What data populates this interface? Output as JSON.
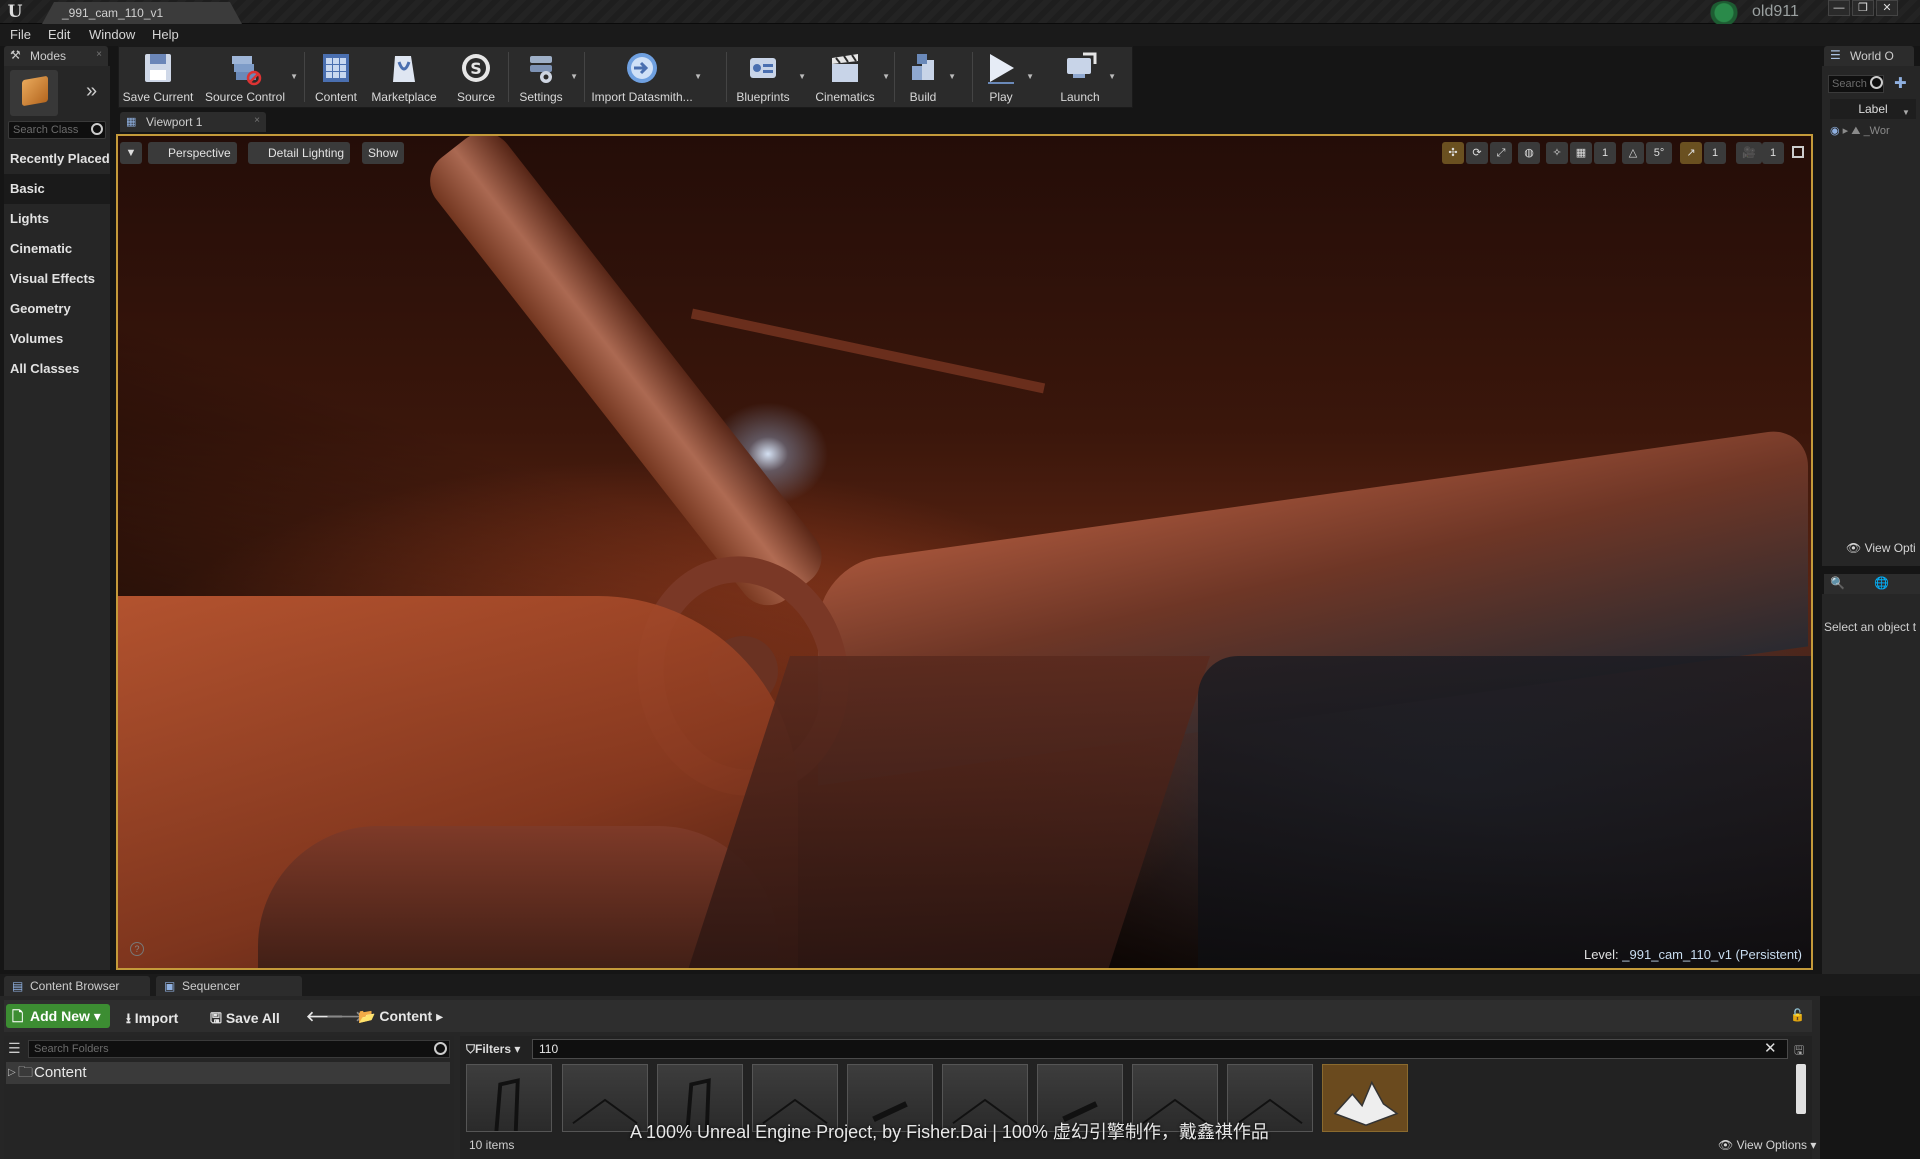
{
  "window": {
    "tab_title": "_991_cam_110_v1",
    "user": "old911",
    "controls": [
      "—",
      "❐",
      "✕"
    ]
  },
  "menu": [
    "File",
    "Edit",
    "Window",
    "Help"
  ],
  "modes": {
    "tab_label": "Modes",
    "search_placeholder": "Search Class",
    "categories": [
      "Recently Placed",
      "Basic",
      "Lights",
      "Cinematic",
      "Visual Effects",
      "Geometry",
      "Volumes",
      "All Classes"
    ],
    "active_category": "Basic"
  },
  "toolbar": [
    {
      "label": "Save Current",
      "icon": "save-icon"
    },
    {
      "label": "Source Control",
      "icon": "source-control-icon"
    },
    {
      "label": "Content",
      "icon": "content-icon"
    },
    {
      "label": "Marketplace",
      "icon": "marketplace-icon"
    },
    {
      "label": "Source",
      "icon": "source-icon"
    },
    {
      "label": "Settings",
      "icon": "settings-icon"
    },
    {
      "label": "Import Datasmith...",
      "icon": "datasmith-icon"
    },
    {
      "label": "Blueprints",
      "icon": "blueprints-icon"
    },
    {
      "label": "Cinematics",
      "icon": "cinematics-icon"
    },
    {
      "label": "Build",
      "icon": "build-icon"
    },
    {
      "label": "Play",
      "icon": "play-icon"
    },
    {
      "label": "Launch",
      "icon": "launch-icon"
    }
  ],
  "viewport": {
    "tab_label": "Viewport 1",
    "buttons": [
      "Perspective",
      "Detail Lighting",
      "Show"
    ],
    "right_icons": [
      "1",
      "5°",
      "1",
      "1"
    ],
    "level_prefix": "Level:",
    "level_name": "_991_cam_110_v1 (Persistent)",
    "accent_color": "#c49a3a"
  },
  "watermark": "A 100% Unreal Engine Project,  by Fisher.Dai | 100% 虚幻引擎制作，戴鑫祺作品",
  "world_outliner": {
    "tab_label": "World O",
    "search_placeholder": "Search",
    "column": "Label",
    "row": "_Wor",
    "view_options": "View Opti"
  },
  "details": {
    "hint": "Select an object t"
  },
  "content_browser": {
    "tabs": [
      "Content Browser",
      "Sequencer"
    ],
    "add_new": "Add New",
    "import": "Import",
    "save_all": "Save All",
    "path": "Content",
    "search_folders_placeholder": "Search Folders",
    "root_folder": "Content",
    "filters_label": "Filters",
    "filter_text": "110",
    "items_count": "10 items",
    "view_options": "View Options",
    "add_new_color": "#3c8d32"
  }
}
